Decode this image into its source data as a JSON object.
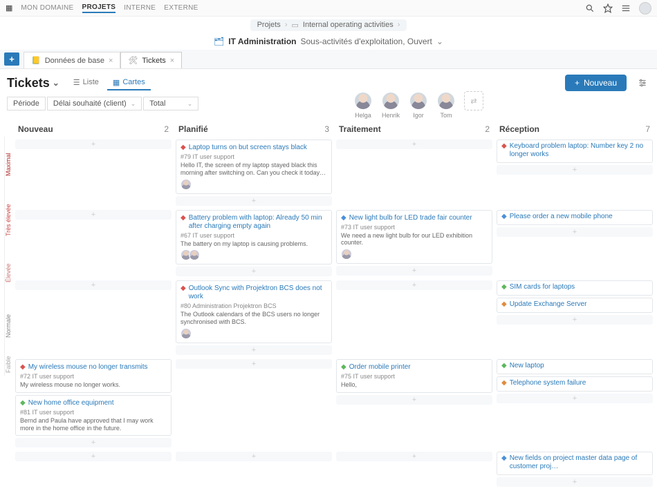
{
  "topnav": {
    "items": [
      "MON DOMAINE",
      "PROJETS",
      "INTERNE",
      "EXTERNE"
    ],
    "active": 1
  },
  "breadcrumb": {
    "root": "Projets",
    "mid": "Internal operating activities"
  },
  "context": {
    "name": "IT Administration",
    "sub": "Sous-activités d'exploitation, Ouvert"
  },
  "tabs": [
    {
      "icon": "📒",
      "label": "Données de base"
    },
    {
      "icon": "🛠",
      "label": "Tickets"
    }
  ],
  "active_tab": 1,
  "page_title": "Tickets",
  "views": {
    "list": "Liste",
    "cards": "Cartes"
  },
  "new_button": "Nouveau",
  "filters": {
    "periode": "Période",
    "delai": "Délai souhaité (client)",
    "total": "Total"
  },
  "people": [
    "Helga",
    "Henrik",
    "Igor",
    "Tom"
  ],
  "lanes": [
    {
      "title": "Nouveau",
      "count": "2"
    },
    {
      "title": "Planifié",
      "count": "3"
    },
    {
      "title": "Traitement",
      "count": "2"
    },
    {
      "title": "Réception",
      "count": "7"
    }
  ],
  "priorities": [
    "Maximal",
    "Très élevée",
    "Élevée",
    "Normale",
    "Faible"
  ],
  "cards": {
    "maximal": {
      "planifie": [
        {
          "ic": "ic-red",
          "title": "Laptop turns on but screen stays black",
          "meta": "#79  IT user support",
          "desc": "Hello IT, the screen of my laptop stayed black this morning after switching on. Can you check it today? I need the laptop urgently for a customer meeting! ...",
          "avatars": 1
        }
      ],
      "reception": [
        {
          "ic": "ic-red",
          "title": "Keyboard problem laptop: Number key 2 no longer works",
          "meta": "",
          "desc": "",
          "avatars": 0
        }
      ]
    },
    "treselevee": {
      "planifie": [
        {
          "ic": "ic-red",
          "title": "Battery problem with laptop: Already 50 min after charging empty again",
          "meta": "#67  IT user support",
          "desc": "The battery on my laptop is causing problems.",
          "avatars": 2
        }
      ],
      "traitement": [
        {
          "ic": "ic-blue",
          "title": "New light bulb for LED trade fair counter",
          "meta": "#73  IT user support",
          "desc": "We need a new light bulb for our LED exhibition counter.",
          "avatars": 1
        }
      ],
      "reception": [
        {
          "ic": "ic-blue",
          "title": "Please order a new mobile phone",
          "meta": "",
          "desc": "",
          "avatars": 0
        }
      ]
    },
    "elevee": {
      "planifie": [
        {
          "ic": "ic-red",
          "title": "Outlook Sync with Projektron BCS does not work",
          "meta": "#80  Administration Projektron BCS",
          "desc": "The Outlook calendars of the BCS users no longer synchronised with BCS.",
          "avatars": 1
        }
      ],
      "reception": [
        {
          "ic": "ic-green",
          "title": "SIM cards for laptops",
          "meta": "",
          "desc": "",
          "avatars": 0
        },
        {
          "ic": "ic-orange",
          "title": "Update Exchange Server",
          "meta": "",
          "desc": "",
          "avatars": 0
        }
      ]
    },
    "normale": {
      "nouveau": [
        {
          "ic": "ic-red",
          "title": "My wireless mouse no longer transmits",
          "meta": "#72  IT user support",
          "desc": "My wireless mouse no longer works.",
          "avatars": 0
        },
        {
          "ic": "ic-green",
          "title": "New home office equipment",
          "meta": "#81  IT user support",
          "desc": "Bernd and Paula have approved that I may work more in the home office in the future.",
          "avatars": 0
        }
      ],
      "traitement": [
        {
          "ic": "ic-green",
          "title": "Order mobile printer",
          "meta": "#75  IT user support",
          "desc": "Hello,",
          "avatars": 0
        }
      ],
      "reception": [
        {
          "ic": "ic-green",
          "title": "New laptop",
          "meta": "",
          "desc": "",
          "avatars": 0
        },
        {
          "ic": "ic-orange",
          "title": "Telephone system failure",
          "meta": "",
          "desc": "",
          "avatars": 0
        }
      ]
    },
    "faible": {
      "reception": [
        {
          "ic": "ic-blue",
          "title": "New fields on project master data page of customer proj…",
          "meta": "",
          "desc": "",
          "avatars": 0
        }
      ]
    }
  }
}
